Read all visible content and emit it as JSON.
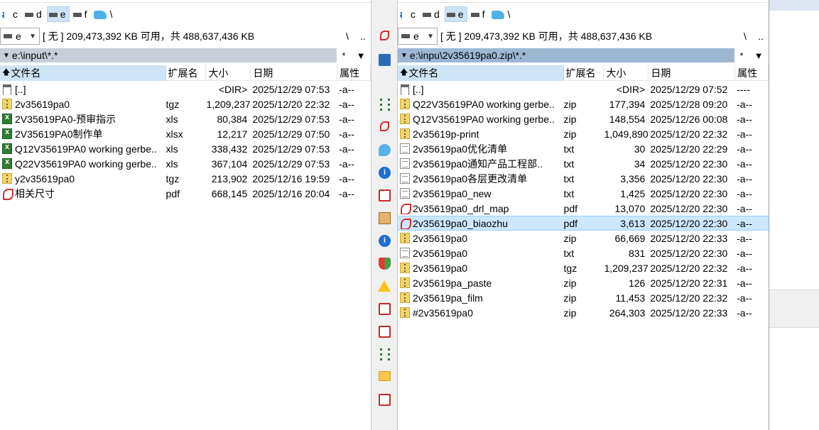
{
  "drives": [
    "c",
    "d",
    "e",
    "f",
    "\\"
  ],
  "left": {
    "drive_combo": "e",
    "free_space": "[ 无 ]  209,473,392 KB 可用，共 488,637,436 KB",
    "nav_root": "\\",
    "nav_up": "..",
    "path": "e:\\input\\*.*",
    "filter": "*",
    "headers": {
      "name": "文件名",
      "ext": "扩展名",
      "size": "大小",
      "date": "日期",
      "attr": "属性"
    },
    "files": [
      {
        "icon": "up-dir-icon",
        "name": "[..]",
        "ext": "",
        "size": "<DIR>",
        "date": "2025/12/29 07:53",
        "attr": "-a--"
      },
      {
        "icon": "zip-icon",
        "name": "2v35619pa0",
        "ext": "tgz",
        "size": "1,209,237",
        "date": "2025/12/20 22:32",
        "attr": "-a--"
      },
      {
        "icon": "excel-icon",
        "name": "2V35619PA0-预审指示",
        "ext": "xls",
        "size": "80,384",
        "date": "2025/12/29 07:53",
        "attr": "-a--"
      },
      {
        "icon": "excel-icon",
        "name": "2V35619PA0制作单",
        "ext": "xlsx",
        "size": "12,217",
        "date": "2025/12/29 07:50",
        "attr": "-a--"
      },
      {
        "icon": "excel-icon",
        "name": "Q12V35619PA0 working gerbe..",
        "ext": "xls",
        "size": "338,432",
        "date": "2025/12/29 07:53",
        "attr": "-a--"
      },
      {
        "icon": "excel-icon",
        "name": "Q22V35619PA0 working gerbe..",
        "ext": "xls",
        "size": "367,104",
        "date": "2025/12/29 07:53",
        "attr": "-a--"
      },
      {
        "icon": "zip-icon",
        "name": "y2v35619pa0",
        "ext": "tgz",
        "size": "213,902",
        "date": "2025/12/16 19:59",
        "attr": "-a--"
      },
      {
        "icon": "pdf-icon",
        "name": "相关尺寸",
        "ext": "pdf",
        "size": "668,145",
        "date": "2025/12/16 20:04",
        "attr": "-a--"
      }
    ]
  },
  "right": {
    "drive_combo": "e",
    "free_space": "[ 无 ]  209,473,392 KB 可用，共 488,637,436 KB",
    "nav_root": "\\",
    "nav_up": "..",
    "path": "e:\\inpu\\2v35619pa0.zip\\*.*",
    "filter": "*",
    "headers": {
      "name": "文件名",
      "ext": "扩展名",
      "size": "大小",
      "date": "日期",
      "attr": "属性"
    },
    "files": [
      {
        "icon": "up-dir-icon",
        "name": "[..]",
        "ext": "",
        "size": "<DIR>",
        "date": "2025/12/29 07:52",
        "attr": "----"
      },
      {
        "icon": "zip-icon",
        "name": "Q22V35619PA0 working gerbe..",
        "ext": "zip",
        "size": "177,394",
        "date": "2025/12/28 09:20",
        "attr": "-a--"
      },
      {
        "icon": "zip-icon",
        "name": "Q12V35619PA0 working gerbe..",
        "ext": "zip",
        "size": "148,554",
        "date": "2025/12/26 00:08",
        "attr": "-a--"
      },
      {
        "icon": "zip-icon",
        "name": "2v35619p-print",
        "ext": "zip",
        "size": "1,049,890",
        "date": "2025/12/20 22:32",
        "attr": "-a--"
      },
      {
        "icon": "text-file-icon",
        "name": "2v35619pa0优化清单",
        "ext": "txt",
        "size": "30",
        "date": "2025/12/20 22:29",
        "attr": "-a--"
      },
      {
        "icon": "text-file-icon",
        "name": "2v35619pa0通知产品工程部..",
        "ext": "txt",
        "size": "34",
        "date": "2025/12/20 22:30",
        "attr": "-a--"
      },
      {
        "icon": "text-file-icon",
        "name": "2v35619pa0各层更改清单",
        "ext": "txt",
        "size": "3,356",
        "date": "2025/12/20 22:30",
        "attr": "-a--"
      },
      {
        "icon": "text-file-icon",
        "name": "2v35619pa0_new",
        "ext": "txt",
        "size": "1,425",
        "date": "2025/12/20 22:30",
        "attr": "-a--"
      },
      {
        "icon": "pdf-icon",
        "name": "2v35619pa0_drl_map",
        "ext": "pdf",
        "size": "13,070",
        "date": "2025/12/20 22:30",
        "attr": "-a--"
      },
      {
        "icon": "pdf-icon",
        "name": "2v35619pa0_biaozhu",
        "ext": "pdf",
        "size": "3,613",
        "date": "2025/12/20 22:30",
        "attr": "-a--",
        "selected": true
      },
      {
        "icon": "zip-icon",
        "name": "2v35619pa0",
        "ext": "zip",
        "size": "66,669",
        "date": "2025/12/20 22:33",
        "attr": "-a--"
      },
      {
        "icon": "text-file-icon",
        "name": "2v35619pa0",
        "ext": "txt",
        "size": "831",
        "date": "2025/12/20 22:30",
        "attr": "-a--"
      },
      {
        "icon": "zip-icon",
        "name": "2v35619pa0",
        "ext": "tgz",
        "size": "1,209,237",
        "date": "2025/12/20 22:32",
        "attr": "-a--"
      },
      {
        "icon": "zip-icon",
        "name": "2v35619pa_paste",
        "ext": "zip",
        "size": "126",
        "date": "2025/12/20 22:31",
        "attr": "-a--"
      },
      {
        "icon": "zip-icon",
        "name": "2v35619pa_film",
        "ext": "zip",
        "size": "11,453",
        "date": "2025/12/20 22:32",
        "attr": "-a--"
      },
      {
        "icon": "zip-icon",
        "name": "#2v35619pa0",
        "ext": "zip",
        "size": "264,303",
        "date": "2025/12/20 22:33",
        "attr": "-a--"
      }
    ]
  },
  "middle_toolbar": [
    "pdf-icon",
    "blue-window-icon",
    "network-icon",
    "pdf-icon",
    "chat-icon",
    "info-icon",
    "red-tool-icon",
    "image-icon",
    "info-icon",
    "shield-icon",
    "warning-icon",
    "red-doc-icon",
    "red-doc-icon",
    "network-icon",
    "folder-icon",
    "red-doc-icon"
  ]
}
